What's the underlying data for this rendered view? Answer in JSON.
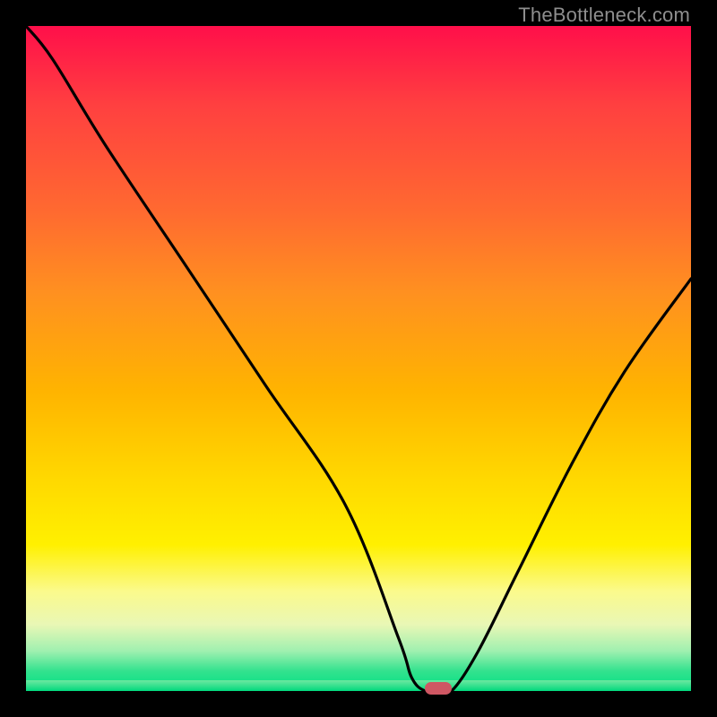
{
  "watermark": "TheBottleneck.com",
  "chart_data": {
    "type": "line",
    "title": "",
    "xlabel": "",
    "ylabel": "",
    "xlim": [
      0,
      100
    ],
    "ylim": [
      0,
      100
    ],
    "grid": false,
    "legend": false,
    "background": "gradient red→yellow→green",
    "x": [
      0,
      4,
      12,
      24,
      36,
      48,
      56,
      58,
      60,
      62,
      64,
      68,
      74,
      82,
      90,
      100
    ],
    "y": [
      100,
      95,
      82,
      64,
      46,
      28,
      8,
      2,
      0,
      0,
      0,
      6,
      18,
      34,
      48,
      62
    ],
    "marker": {
      "x": 62,
      "y": 0,
      "color": "#cf5763"
    },
    "note": "Bottleneck-style V-curve; minimum (~0) around x≈60–64, rises steeply on both sides"
  },
  "colors": {
    "frame": "#000000",
    "curve": "#000000",
    "marker": "#cf5763",
    "watermark": "#8e8e8e"
  }
}
